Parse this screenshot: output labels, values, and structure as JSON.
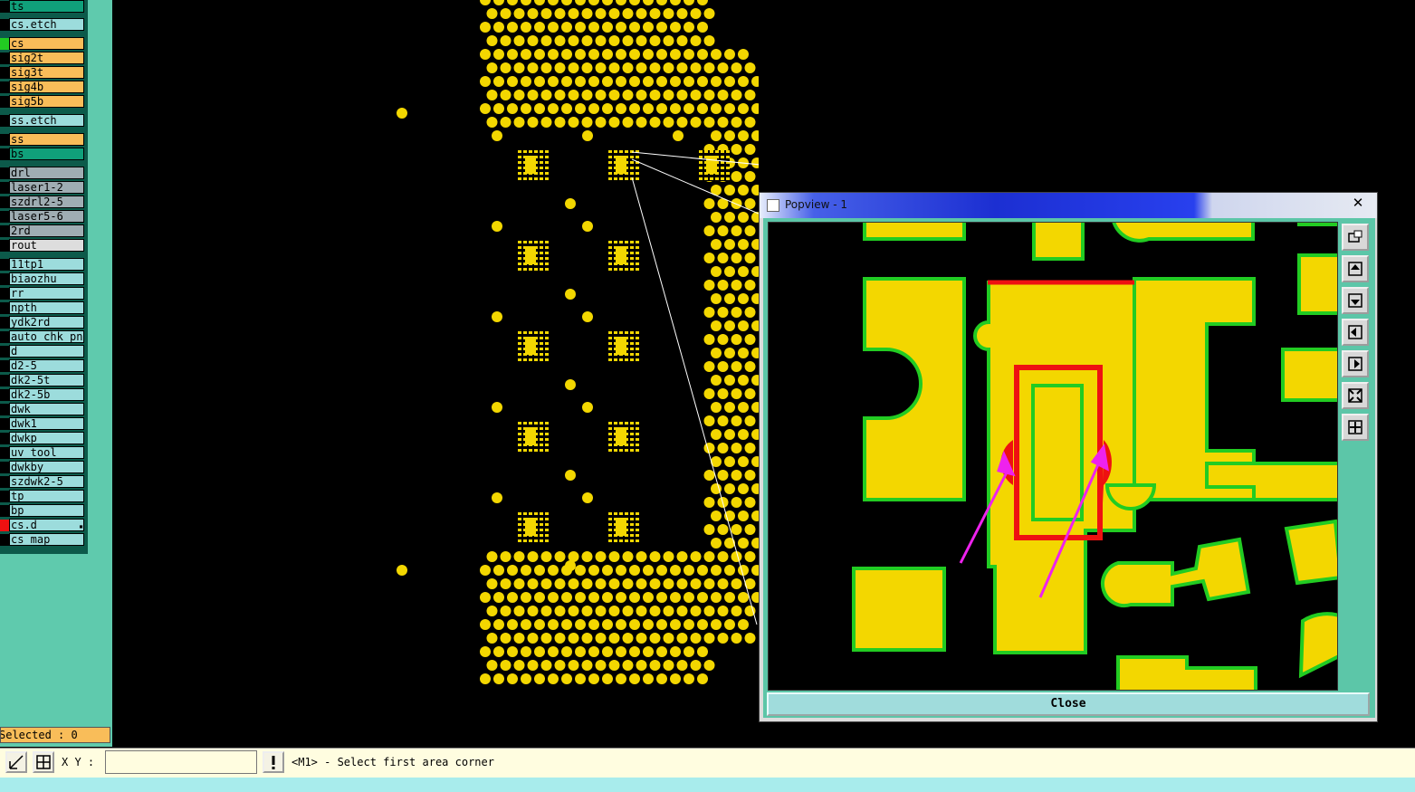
{
  "layers": [
    {
      "label": "ts",
      "mark": "#000000",
      "bg": "#10a07a"
    },
    {
      "label": "cs.etch",
      "mark": "#000000",
      "bg": "#9cdcdc"
    },
    {
      "label": "cs",
      "mark": "#22cc22",
      "bg": "#f9bd59"
    },
    {
      "label": "sig2t",
      "mark": "#000000",
      "bg": "#f9bd59"
    },
    {
      "label": "sig3t",
      "mark": "#000000",
      "bg": "#f9bd59"
    },
    {
      "label": "sig4b",
      "mark": "#000000",
      "bg": "#f9bd59"
    },
    {
      "label": "sig5b",
      "mark": "#000000",
      "bg": "#f9bd59"
    },
    {
      "label": "ss.etch",
      "mark": "#000000",
      "bg": "#9cdcdc"
    },
    {
      "label": "ss",
      "mark": "#000000",
      "bg": "#f9bd59"
    },
    {
      "label": "bs",
      "mark": "#000000",
      "bg": "#10a07a"
    },
    {
      "label": "drl",
      "mark": "#000000",
      "bg": "#9fadb3"
    },
    {
      "label": "laser1-2",
      "mark": "#000000",
      "bg": "#9fadb3"
    },
    {
      "label": "szdrl2-5",
      "mark": "#000000",
      "bg": "#9fadb3"
    },
    {
      "label": "laser5-6",
      "mark": "#000000",
      "bg": "#9fadb3"
    },
    {
      "label": "2rd",
      "mark": "#000000",
      "bg": "#9fadb3"
    },
    {
      "label": "rout",
      "mark": "#000000",
      "bg": "#dddddd"
    },
    {
      "label": "11tp1",
      "mark": "#000000",
      "bg": "#9cdcdc"
    },
    {
      "label": "biaozhu",
      "mark": "#000000",
      "bg": "#9cdcdc"
    },
    {
      "label": "rr",
      "mark": "#000000",
      "bg": "#9cdcdc"
    },
    {
      "label": "npth",
      "mark": "#000000",
      "bg": "#9cdcdc"
    },
    {
      "label": "ydk2rd",
      "mark": "#000000",
      "bg": "#9cdcdc"
    },
    {
      "label": "auto_chk_pnl",
      "mark": "#000000",
      "bg": "#9cdcdc"
    },
    {
      "label": "d",
      "mark": "#000000",
      "bg": "#9cdcdc"
    },
    {
      "label": "d2-5",
      "mark": "#000000",
      "bg": "#9cdcdc"
    },
    {
      "label": "dk2-5t",
      "mark": "#000000",
      "bg": "#9cdcdc"
    },
    {
      "label": "dk2-5b",
      "mark": "#000000",
      "bg": "#9cdcdc"
    },
    {
      "label": "dwk",
      "mark": "#000000",
      "bg": "#9cdcdc"
    },
    {
      "label": "dwk1",
      "mark": "#000000",
      "bg": "#9cdcdc"
    },
    {
      "label": "dwkp",
      "mark": "#000000",
      "bg": "#9cdcdc"
    },
    {
      "label": "uv_tool",
      "mark": "#000000",
      "bg": "#9cdcdc"
    },
    {
      "label": "dwkby",
      "mark": "#000000",
      "bg": "#9cdcdc"
    },
    {
      "label": "szdwk2-5",
      "mark": "#000000",
      "bg": "#9cdcdc"
    },
    {
      "label": "tp",
      "mark": "#000000",
      "bg": "#9cdcdc"
    },
    {
      "label": "bp",
      "mark": "#000000",
      "bg": "#9cdcdc"
    },
    {
      "label": "cs.d",
      "mark": "#ee1111",
      "bg": "#9cdcdc"
    },
    {
      "label": "cs_map",
      "mark": "#000000",
      "bg": "#9cdcdc"
    }
  ],
  "selected_text": "Selected : 0",
  "status": {
    "xy_label": "X Y :",
    "xy_value": "",
    "prompt": "<M1> - Select first area corner"
  },
  "popview": {
    "title": "Popview - 1",
    "close_glyph": "✕",
    "close_label": "Close",
    "tools": [
      "zoom-window-icon",
      "pan-up-icon",
      "pan-down-icon",
      "pan-left-icon",
      "pan-right-icon",
      "zoom-fit-icon",
      "zoom-center-icon"
    ]
  },
  "colors": {
    "copper": "#f3d700",
    "outline_green": "#22cc22",
    "highlight_red": "#ee1111",
    "annotation_magenta": "#ee22ee",
    "panel_teal": "#5fcaad"
  }
}
